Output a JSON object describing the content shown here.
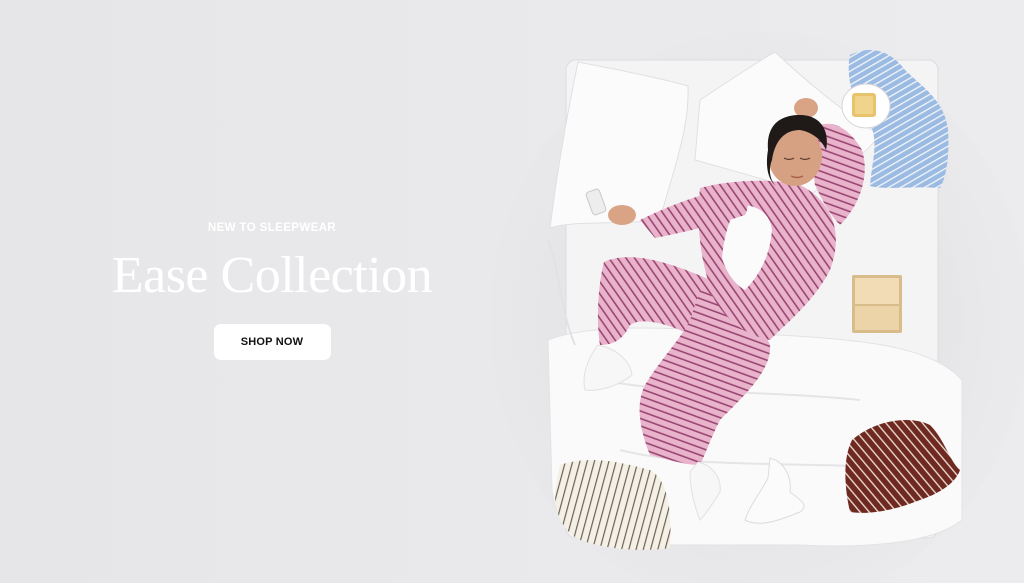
{
  "hero": {
    "eyebrow": "NEW TO SLEEPWEAR",
    "title": "Ease Collection",
    "cta_label": "SHOP NOW"
  },
  "colors": {
    "background": "#e6e6e8",
    "text": "#ffffff",
    "button_bg": "#ffffff",
    "button_text": "#111111",
    "pajama_pink": "#e6aec8",
    "pajama_stripe": "#8a3d66",
    "shirt_blue": "#9ab7e0",
    "shirt_brown": "#6e2d22"
  },
  "image": {
    "subject": "woman sleeping on white bed in pink striped pajamas"
  }
}
